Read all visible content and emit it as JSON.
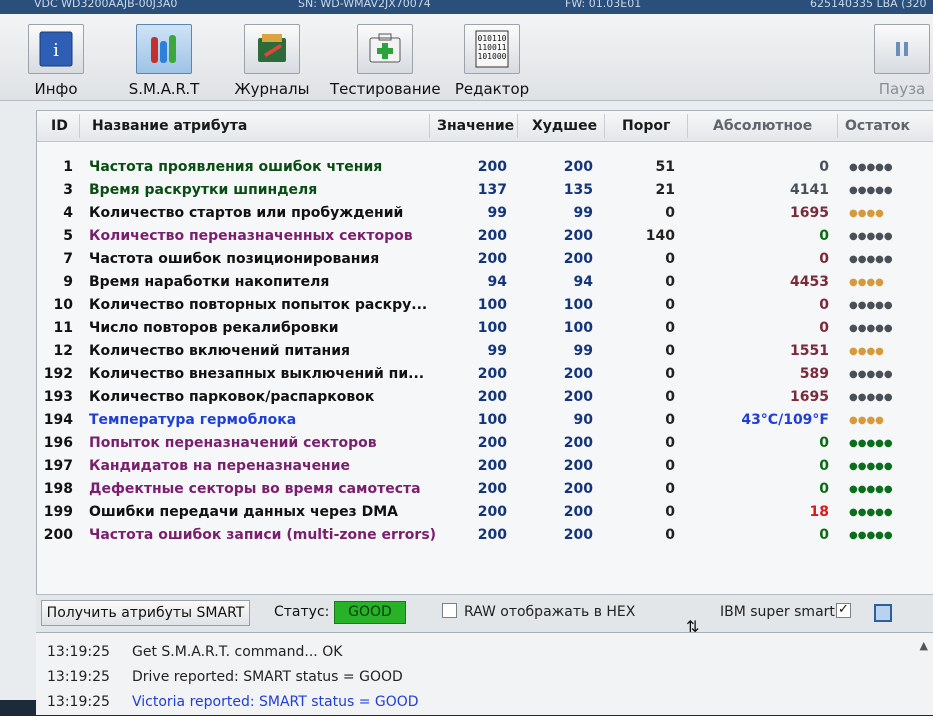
{
  "titlebar": {
    "left": "VDC WD3200AAJB-00J3A0",
    "mid": "SN: WD-WMAV2JX70074",
    "fw": "FW: 01.03E01",
    "lba": "625140335 LBA (320"
  },
  "toolbar": {
    "buttons": [
      {
        "label": "Инфо",
        "icon": "info-icon"
      },
      {
        "label": "S.M.A.R.T",
        "icon": "smart-tubes-icon"
      },
      {
        "label": "Журналы",
        "icon": "journal-icon"
      },
      {
        "label": "Тестирование",
        "icon": "test-medkit-icon"
      },
      {
        "label": "Редактор",
        "icon": "binary-editor-icon"
      },
      {
        "label": "Пауза",
        "icon": "pause-icon"
      }
    ]
  },
  "table": {
    "columns": {
      "id": "ID",
      "name": "Название атрибута",
      "value": "Значение",
      "worst": "Худшее",
      "threshold": "Порог",
      "raw": "Абсолютное",
      "remaining": "Остаток"
    },
    "rows": [
      {
        "id": "1",
        "name": "Частота проявления ошибок чтения",
        "value": "200",
        "worst": "200",
        "threshold": "51",
        "raw": "0",
        "remaining": "●●●●●"
      },
      {
        "id": "3",
        "name": "Время раскрутки шпинделя",
        "value": "137",
        "worst": "135",
        "threshold": "21",
        "raw": "4141",
        "remaining": "●●●●●"
      },
      {
        "id": "4",
        "name": "Количество стартов или пробуждений",
        "value": "99",
        "worst": "99",
        "threshold": "0",
        "raw": "1695",
        "remaining": "●●●●"
      },
      {
        "id": "5",
        "name": "Количество переназначенных секторов",
        "value": "200",
        "worst": "200",
        "threshold": "140",
        "raw": "0",
        "remaining": "●●●●●"
      },
      {
        "id": "7",
        "name": "Частота ошибок позиционирования",
        "value": "200",
        "worst": "200",
        "threshold": "0",
        "raw": "0",
        "remaining": "●●●●●"
      },
      {
        "id": "9",
        "name": "Время наработки накопителя",
        "value": "94",
        "worst": "94",
        "threshold": "0",
        "raw": "4453",
        "remaining": "●●●●"
      },
      {
        "id": "10",
        "name": "Количество повторных попыток раскру...",
        "value": "100",
        "worst": "100",
        "threshold": "0",
        "raw": "0",
        "remaining": "●●●●●"
      },
      {
        "id": "11",
        "name": "Число повторов рекалибровки",
        "value": "100",
        "worst": "100",
        "threshold": "0",
        "raw": "0",
        "remaining": "●●●●●"
      },
      {
        "id": "12",
        "name": "Количество включений питания",
        "value": "99",
        "worst": "99",
        "threshold": "0",
        "raw": "1551",
        "remaining": "●●●●"
      },
      {
        "id": "192",
        "name": "Количество внезапных выключений пи...",
        "value": "200",
        "worst": "200",
        "threshold": "0",
        "raw": "589",
        "remaining": "●●●●●"
      },
      {
        "id": "193",
        "name": "Количество парковок/распарковок",
        "value": "200",
        "worst": "200",
        "threshold": "0",
        "raw": "1695",
        "remaining": "●●●●●"
      },
      {
        "id": "194",
        "name": "Температура гермоблока",
        "value": "100",
        "worst": "90",
        "threshold": "0",
        "raw": "43°C/109°F",
        "remaining": "●●●●"
      },
      {
        "id": "196",
        "name": "Попыток переназначений секторов",
        "value": "200",
        "worst": "200",
        "threshold": "0",
        "raw": "0",
        "remaining": "●●●●●"
      },
      {
        "id": "197",
        "name": "Кандидатов на переназначение",
        "value": "200",
        "worst": "200",
        "threshold": "0",
        "raw": "0",
        "remaining": "●●●●●"
      },
      {
        "id": "198",
        "name": "Дефектные секторы во время самотеста",
        "value": "200",
        "worst": "200",
        "threshold": "0",
        "raw": "0",
        "remaining": "●●●●●"
      },
      {
        "id": "199",
        "name": "Ошибки передачи данных через DMA",
        "value": "200",
        "worst": "200",
        "threshold": "0",
        "raw": "18",
        "remaining": "●●●●●"
      },
      {
        "id": "200",
        "name": "Частота ошибок записи (multi-zone errors)",
        "value": "200",
        "worst": "200",
        "threshold": "0",
        "raw": "0",
        "remaining": "●●●●●"
      }
    ]
  },
  "controls": {
    "get_button": "Получить атрибуты SMART",
    "status_label": "Статус:",
    "status_value": "GOOD",
    "raw_hex_label": "RAW отображать в HEX",
    "ibm_label": "IBM super smart:",
    "ibm_checked": "✓"
  },
  "log": [
    {
      "time": "13:19:25",
      "msg": "Get S.M.A.R.T. command... OK"
    },
    {
      "time": "13:19:25",
      "msg": "Drive reported: SMART status = GOOD"
    },
    {
      "time": "13:19:25",
      "msg": "Victoria reported: SMART status = GOOD"
    }
  ],
  "colors": {
    "name_green": "#0a4d12",
    "name_black": "#111111",
    "name_purple": "#7a1f6e",
    "name_blue": "#1f3fd6",
    "value_blue": "#14357a",
    "raw_maroon": "#7a2a3a",
    "raw_green": "#0a6b12",
    "raw_red": "#d81a1a",
    "dots_gray": "#4a5058",
    "dots_yellow": "#d69a3a",
    "dots_green": "#0b6e1c",
    "status_green": "#27b227",
    "log_blue": "#1f3fd6"
  }
}
